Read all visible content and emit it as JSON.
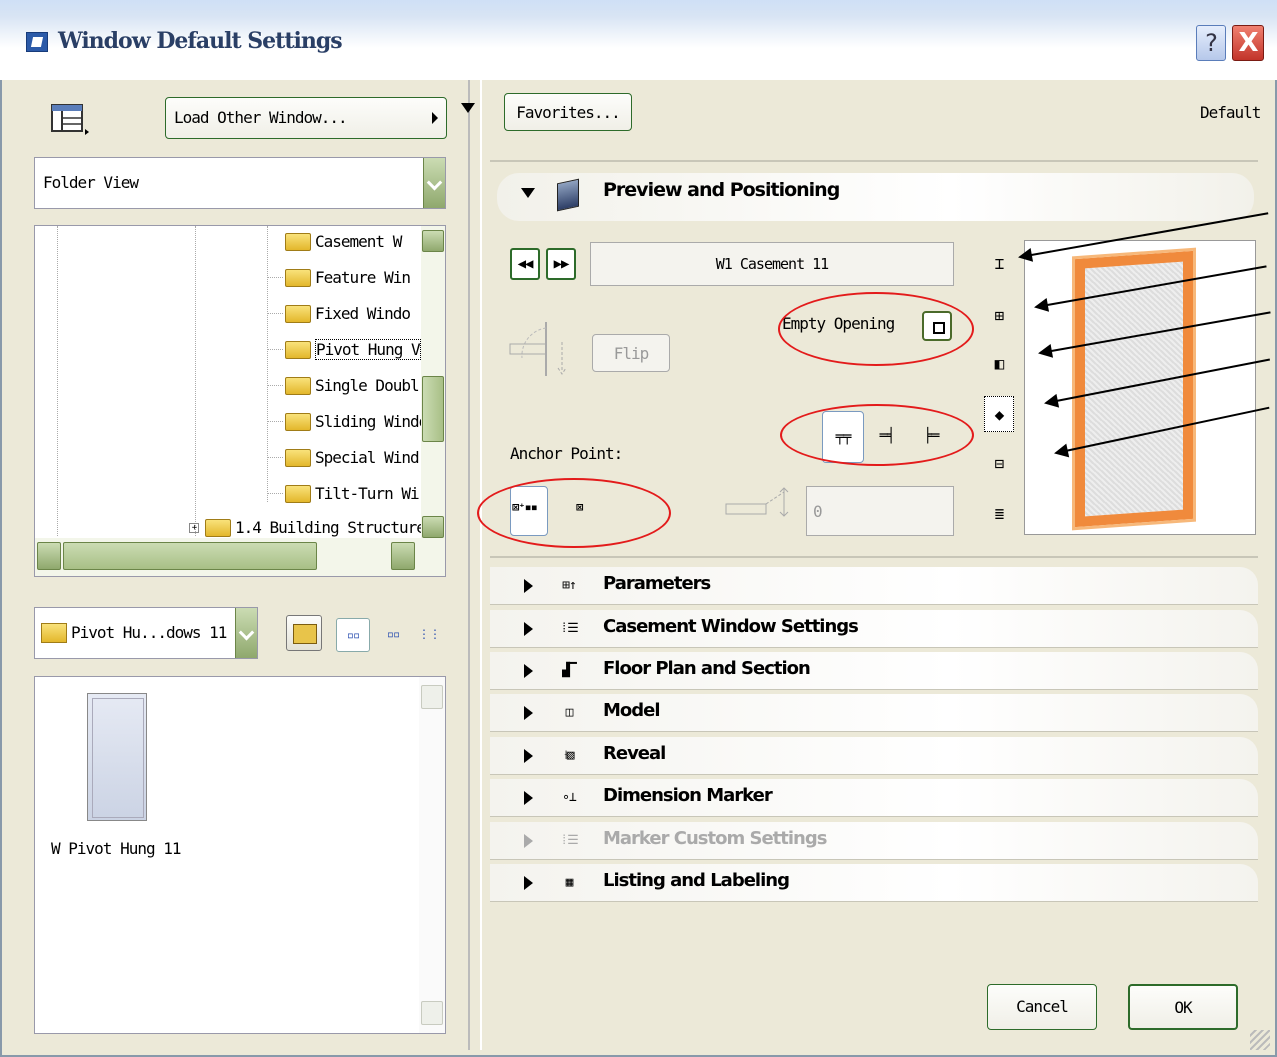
{
  "window": {
    "title": "Window Default Settings",
    "help_label": "?",
    "close_label": "X"
  },
  "left": {
    "load_label": "Load Other Window...",
    "view_mode": "Folder View",
    "tree_items": [
      {
        "label": "Casement W",
        "selected": false
      },
      {
        "label": "Feature Win",
        "selected": false
      },
      {
        "label": "Fixed Windo",
        "selected": false
      },
      {
        "label": "Pivot Hung V",
        "selected": true
      },
      {
        "label": "Single Doubl",
        "selected": false
      },
      {
        "label": "Sliding Windo",
        "selected": false
      },
      {
        "label": "Special Wind",
        "selected": false
      },
      {
        "label": "Tilt-Turn Wir",
        "selected": false
      }
    ],
    "tree_parent_label": "1.4 Building Structure",
    "current_folder": "Pivot Hu...dows 11",
    "item_label": "W Pivot Hung 11"
  },
  "right": {
    "favorites_label": "Favorites...",
    "default_label": "Default",
    "section_title": "Preview and Positioning",
    "name_field": "W1 Casement 11",
    "flip_label": "Flip",
    "empty_opening_label": "Empty Opening",
    "anchor_label": "Anchor Point:",
    "offset_value": "0",
    "sections": [
      {
        "label": "Parameters",
        "icon": "parameters-icon",
        "enabled": true
      },
      {
        "label": "Casement Window Settings",
        "icon": "settings-icon",
        "enabled": true
      },
      {
        "label": "Floor Plan and Section",
        "icon": "floor-plan-icon",
        "enabled": true
      },
      {
        "label": "Model",
        "icon": "model-icon",
        "enabled": true
      },
      {
        "label": "Reveal",
        "icon": "reveal-icon",
        "enabled": true
      },
      {
        "label": "Dimension Marker",
        "icon": "dimension-marker-icon",
        "enabled": true
      },
      {
        "label": "Marker Custom Settings",
        "icon": "marker-icon",
        "enabled": false
      },
      {
        "label": "Listing and Labeling",
        "icon": "listing-icon",
        "enabled": true
      }
    ],
    "side_icons": [
      "elevation-icon",
      "plan-icon",
      "side-view-icon",
      "3d-view-icon",
      "section-icon",
      "list-icon"
    ],
    "selected_side_icon": "3d-view-icon"
  },
  "footer": {
    "cancel_label": "Cancel",
    "ok_label": "OK"
  },
  "colors": {
    "annotation_red": "#e31b1b",
    "button_border": "#2d6b2a",
    "window_frame_orange": "#f08a3c"
  }
}
